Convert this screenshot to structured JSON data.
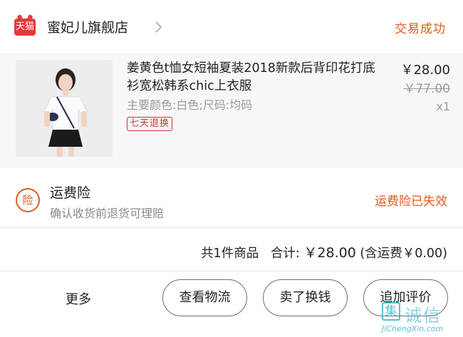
{
  "shop": {
    "badge_text": "天猫",
    "name": "蜜妃儿旗舰店",
    "status": "交易成功"
  },
  "product": {
    "title": "姜黄色t恤女短袖夏装2018新款后背印花打底衫宽松韩系chic上衣服",
    "spec": "主要颜色:白色;尺码:均码",
    "return_badge": "七天退换",
    "price_now": "￥28.00",
    "price_original": "￥77.00",
    "quantity": "x1"
  },
  "insurance": {
    "icon_text": "险",
    "title": "运费险",
    "subtitle": "确认收货前退货可理赔",
    "status": "运费险已失效"
  },
  "total": {
    "count_label": "共1件商品",
    "sum_label": "合计:",
    "amount": "￥28.00",
    "shipping_note": "(含运费￥0.00)"
  },
  "actions": {
    "more": "更多",
    "view_logistics": "查看物流",
    "resell": "卖了换钱",
    "add_review": "追加评价"
  },
  "watermark": {
    "chars": "诚信",
    "box_char": "集",
    "domain": "JiChengXin.com"
  },
  "colors": {
    "accent": "#e35a1b",
    "tmall_red": "#e4393c",
    "badge_red": "#d0343b",
    "product_bg": "#f7f7f7",
    "watermark": "#3ab7c9"
  },
  "icons": {
    "shop_link": "chevron-right-icon",
    "insurance": "insurance-circle-icon"
  }
}
